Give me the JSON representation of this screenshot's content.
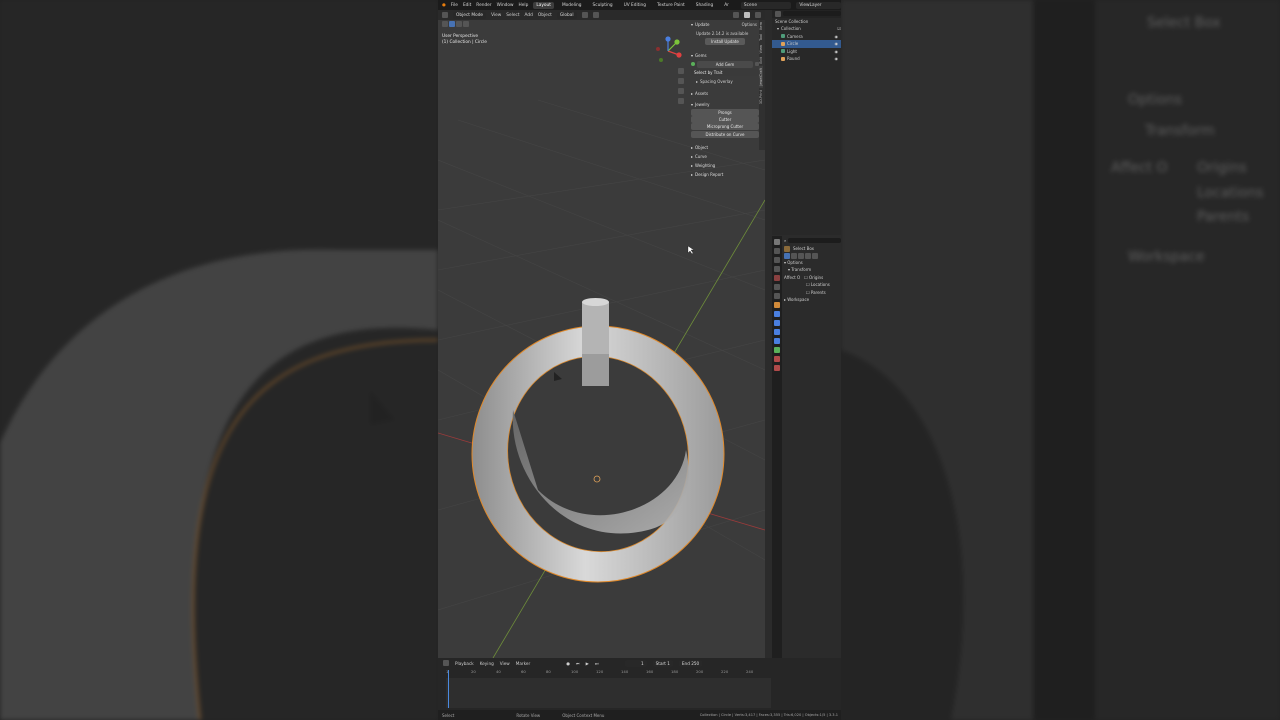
{
  "top_menu": {
    "items": [
      "File",
      "Edit",
      "Render",
      "Window",
      "Help"
    ],
    "workspaces": [
      "Layout",
      "Modeling",
      "Sculpting",
      "UV Editing",
      "Texture Paint",
      "Shading",
      "Ar"
    ],
    "active_workspace": "Layout",
    "scene": "Scene",
    "view_layer": "ViewLayer"
  },
  "viewport": {
    "mode": "Object Mode",
    "menus": [
      "View",
      "Select",
      "Add",
      "Object"
    ],
    "orientation": "Global",
    "info_line1": "User Perspective",
    "info_line2": "(1) Collection | Circle",
    "options_label": "Options",
    "gizmo_axes": {
      "x": "#e04040",
      "y": "#7cc43a",
      "z": "#4a7fe0"
    }
  },
  "n_panel": {
    "update_title": "Update",
    "update_message": "Update 2.14.2 is available",
    "install_button": "Install Update",
    "gems_section": "Gems",
    "add_gem_button": "Add Gem",
    "select_by_trait": "Select by Trait",
    "spacing_overlay": "Spacing Overlay",
    "assets_section": "Assets",
    "jewelry_section": "Jewelry",
    "jewelry_buttons": [
      "Prongs",
      "Cutter",
      "Microprong Cutter"
    ],
    "distribute_button": "Distribute on Curve",
    "sections": [
      "Object",
      "Curve",
      "Weighting",
      "Design Report"
    ],
    "side_tabs": [
      "Item",
      "Tool",
      "View",
      "Edit",
      "JewelCraft",
      "3D-Print"
    ]
  },
  "outliner": {
    "root": "Scene Collection",
    "collection": "Collection",
    "objects": [
      {
        "name": "Camera",
        "icon_color": "#4f9c7a",
        "selected": false
      },
      {
        "name": "Circle",
        "icon_color": "#e0a25a",
        "selected": true
      },
      {
        "name": "Light",
        "icon_color": "#4f9c7a",
        "selected": false
      },
      {
        "name": "Round",
        "icon_color": "#e0a25a",
        "selected": false
      }
    ]
  },
  "properties": {
    "tool_name": "Select Box",
    "options": "Options",
    "transform": "Transform",
    "affect_only": "Affect O",
    "checkboxes": [
      "Origins",
      "Locations",
      "Parents"
    ],
    "workspace": "Workspace"
  },
  "timeline": {
    "menus": [
      "Playback",
      "Keying",
      "View",
      "Marker"
    ],
    "current_frame": "1",
    "start_label": "Start",
    "start": "1",
    "end_label": "End",
    "end": "250",
    "ticks": [
      "1",
      "20",
      "40",
      "60",
      "80",
      "100",
      "120",
      "140",
      "160",
      "180",
      "200",
      "220",
      "240"
    ]
  },
  "status_bar": {
    "left": "Select",
    "middle": "Rotate View",
    "context": "Object Context Menu",
    "stats": "Collection | Circle | Verts:3,417 | Faces:3,355 | Tris:6,020 | Objects:1/5 | 3.3.1"
  },
  "background": {
    "tool_name": "Select Box",
    "options": "Options",
    "transform": "Transform",
    "affect_only": "Affect O",
    "checkboxes": [
      "Origins",
      "Locations",
      "Parents"
    ],
    "workspace": "Workspace"
  }
}
